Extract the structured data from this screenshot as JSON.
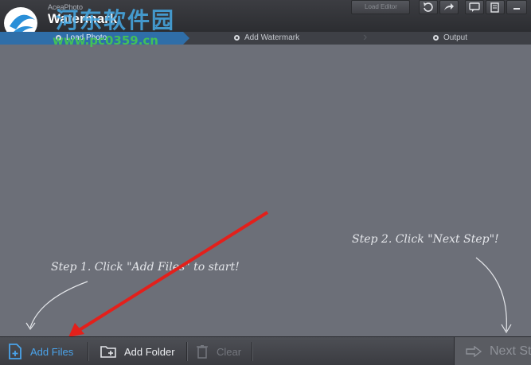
{
  "titlebar": {
    "app_subtitle": "AceaPhoto",
    "app_title": "Watermark",
    "disabled_button_label": "Load Editor",
    "site_watermark": "河东软件园",
    "site_url": "www.pc0359.cn"
  },
  "steps": [
    {
      "label": "Load Photo"
    },
    {
      "label": "Add Watermark"
    },
    {
      "label": "Output"
    }
  ],
  "hints": {
    "step1": "Step 1. Click \"Add Files\" to start!",
    "step2": "Step 2. Click \"Next Step\"!"
  },
  "toolbar": {
    "add_files": "Add Files",
    "add_folder": "Add Folder",
    "clear": "Clear",
    "next_step": "Next Step"
  },
  "colors": {
    "accent": "#2f6ea8",
    "link_blue": "#4aa3ea",
    "annotation_arrow": "#e3201b",
    "workspace": "#6c6f78"
  }
}
